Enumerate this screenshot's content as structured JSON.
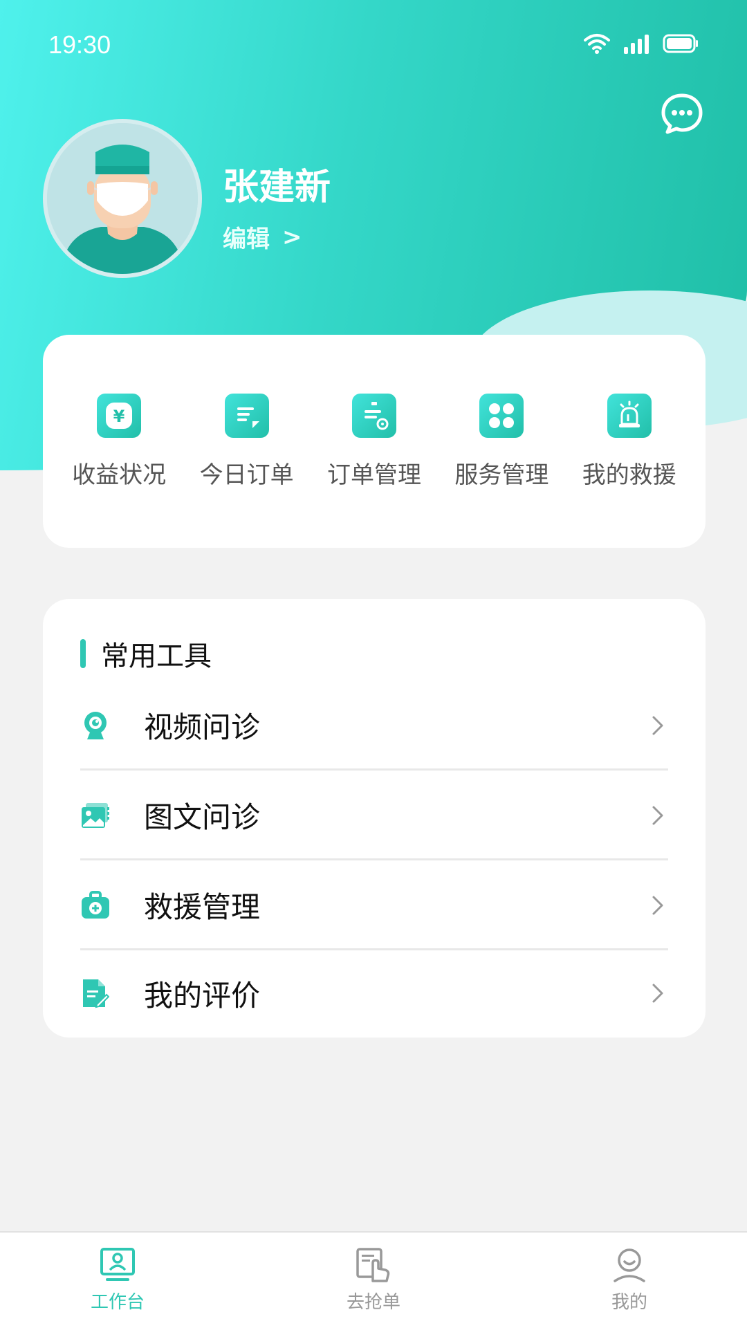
{
  "status_bar": {
    "time": "19:30"
  },
  "profile": {
    "name": "张建新",
    "edit_label": "编辑",
    "edit_arrow": ">"
  },
  "quick_actions": [
    {
      "label": "收益状况",
      "icon": "yuan-icon"
    },
    {
      "label": "今日订单",
      "icon": "document-icon"
    },
    {
      "label": "订单管理",
      "icon": "order-settings-icon"
    },
    {
      "label": "服务管理",
      "icon": "grid-icon"
    },
    {
      "label": "我的救援",
      "icon": "alarm-light-icon"
    }
  ],
  "tools": {
    "title": "常用工具",
    "items": [
      {
        "label": "视频问诊",
        "icon": "webcam-icon"
      },
      {
        "label": "图文问诊",
        "icon": "image-text-icon"
      },
      {
        "label": "救援管理",
        "icon": "medical-kit-icon"
      },
      {
        "label": "我的评价",
        "icon": "edit-document-icon"
      }
    ]
  },
  "bottom_nav": [
    {
      "label": "工作台",
      "icon": "workbench-icon",
      "active": true
    },
    {
      "label": "去抢单",
      "icon": "grab-order-icon",
      "active": false
    },
    {
      "label": "我的",
      "icon": "profile-icon",
      "active": false
    }
  ],
  "colors": {
    "accent": "#2fc7b3",
    "gradient_start": "#4ff1ec",
    "gradient_end": "#1fbea6"
  }
}
